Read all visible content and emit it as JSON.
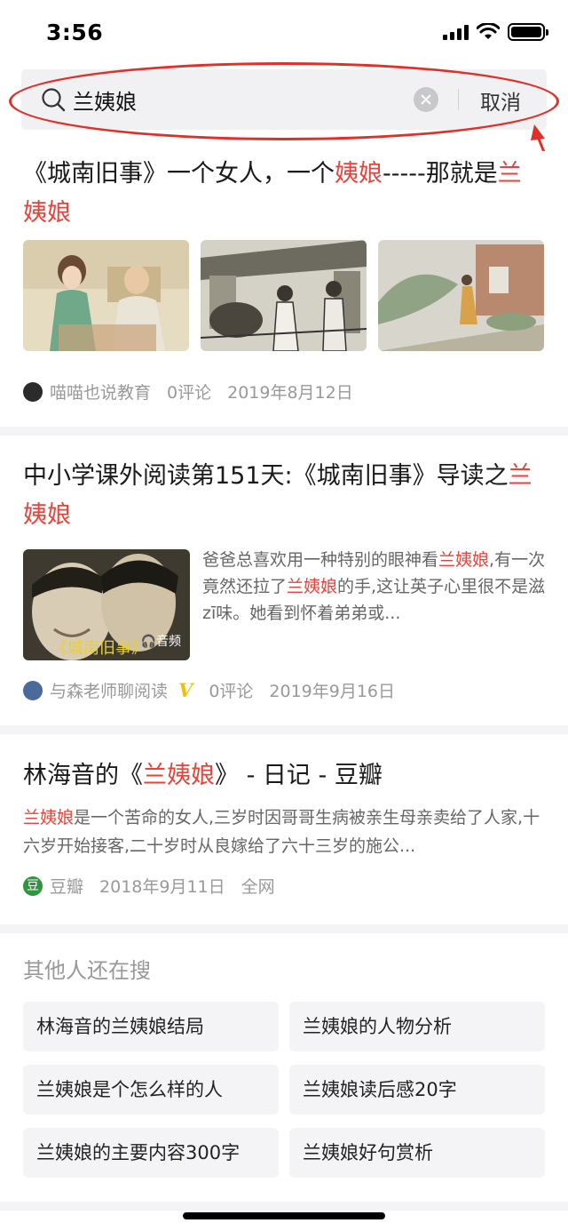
{
  "status": {
    "time": "3:56"
  },
  "search": {
    "query": "兰姨娘",
    "cancel": "取消"
  },
  "results": [
    {
      "title_parts": [
        "《城南旧事》一个女人，一个",
        "姨娘",
        "-----那就是",
        "兰姨娘"
      ],
      "author": "喵喵也说教育",
      "comments": "0评论",
      "date": "2019年8月12日"
    },
    {
      "title_parts": [
        "中小学课外阅读第151天:《城南旧事》导读之",
        "兰姨娘"
      ],
      "snippet_parts": [
        "爸爸总喜欢用一种特别的眼神看",
        "兰姨娘",
        ",有一次竟然还拉了",
        "兰姨娘",
        "的手,这让英子心里很不是滋zī味。她看到怀着弟弟或..."
      ],
      "thumb_caption": "《城南旧事》",
      "audio_label": "音频",
      "author": "与森老师聊阅读",
      "verified": "V",
      "comments": "0评论",
      "date": "2019年9月16日"
    },
    {
      "title_parts": [
        "林海音的《",
        "兰姨娘",
        "》 - 日记 - 豆瓣"
      ],
      "snippet_parts": [
        "兰姨娘",
        "是一个苦命的女人,三岁时因哥哥生病被亲生母亲卖给了人家,十六岁开始接客,二十岁时从良嫁给了六十三岁的施公..."
      ],
      "source_badge": "豆",
      "source": "豆瓣",
      "date": "2018年9月11日",
      "scope": "全网"
    }
  ],
  "others": {
    "title": "其他人还在搜",
    "chips": [
      "林海音的兰姨娘结局",
      "兰姨娘的人物分析",
      "兰姨娘是个怎么样的人",
      "兰姨娘读后感20字",
      "兰姨娘的主要内容300字",
      "兰姨娘好句赏析"
    ]
  },
  "colors": {
    "highlight": "#e8433b",
    "annotation": "#e0302a",
    "douban": "#2e963d"
  }
}
